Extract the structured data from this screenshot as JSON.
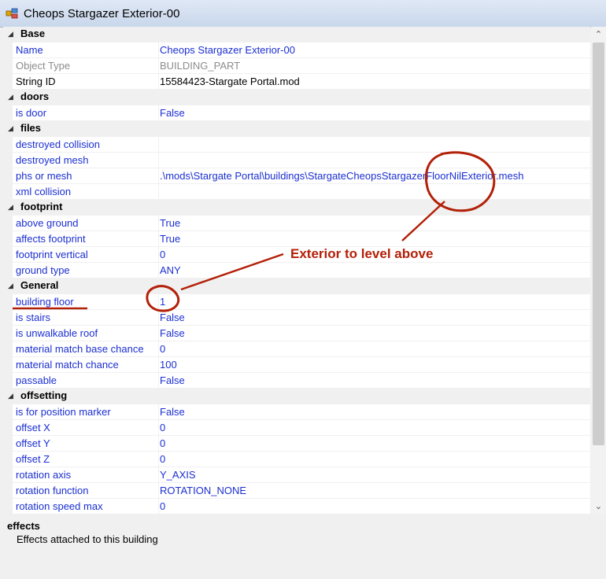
{
  "window": {
    "title": "Cheops Stargazer Exterior-00"
  },
  "grid": {
    "rows": [
      {
        "type": "category",
        "label": "Base"
      },
      {
        "type": "prop",
        "name": "Name",
        "value": "Cheops Stargazer Exterior-00",
        "state": "editable"
      },
      {
        "type": "prop",
        "name": "Object Type",
        "value": "BUILDING_PART",
        "state": "readonly"
      },
      {
        "type": "prop",
        "name": "String ID",
        "value": "15584423-Stargate Portal.mod",
        "state": "plain"
      },
      {
        "type": "category",
        "label": "doors"
      },
      {
        "type": "prop",
        "name": "is door",
        "value": "False",
        "state": "editable"
      },
      {
        "type": "category",
        "label": "files"
      },
      {
        "type": "prop",
        "name": "destroyed collision",
        "value": "",
        "state": "editable"
      },
      {
        "type": "prop",
        "name": "destroyed mesh",
        "value": "",
        "state": "editable"
      },
      {
        "type": "prop",
        "name": "phs or mesh",
        "value": ".\\mods\\Stargate Portal\\buildings\\StargateCheopsStargazerFloorNilExterior.mesh",
        "state": "editable"
      },
      {
        "type": "prop",
        "name": "xml collision",
        "value": "",
        "state": "editable"
      },
      {
        "type": "category",
        "label": "footprint"
      },
      {
        "type": "prop",
        "name": "above ground",
        "value": "True",
        "state": "editable"
      },
      {
        "type": "prop",
        "name": "affects footprint",
        "value": "True",
        "state": "editable"
      },
      {
        "type": "prop",
        "name": "footprint vertical",
        "value": "0",
        "state": "editable"
      },
      {
        "type": "prop",
        "name": "ground type",
        "value": "ANY",
        "state": "editable"
      },
      {
        "type": "category",
        "label": "General"
      },
      {
        "type": "prop",
        "name": "building floor",
        "value": "1",
        "state": "editable"
      },
      {
        "type": "prop",
        "name": "is stairs",
        "value": "False",
        "state": "editable"
      },
      {
        "type": "prop",
        "name": "is unwalkable roof",
        "value": "False",
        "state": "editable"
      },
      {
        "type": "prop",
        "name": "material match base chance",
        "value": "0",
        "state": "editable"
      },
      {
        "type": "prop",
        "name": "material match chance",
        "value": "100",
        "state": "editable"
      },
      {
        "type": "prop",
        "name": "passable",
        "value": "False",
        "state": "editable"
      },
      {
        "type": "category",
        "label": "offsetting"
      },
      {
        "type": "prop",
        "name": "is for position marker",
        "value": "False",
        "state": "editable"
      },
      {
        "type": "prop",
        "name": "offset X",
        "value": "0",
        "state": "editable"
      },
      {
        "type": "prop",
        "name": "offset Y",
        "value": "0",
        "state": "editable"
      },
      {
        "type": "prop",
        "name": "offset Z",
        "value": "0",
        "state": "editable"
      },
      {
        "type": "prop",
        "name": "rotation axis",
        "value": "Y_AXIS",
        "state": "editable"
      },
      {
        "type": "prop",
        "name": "rotation function",
        "value": "ROTATION_NONE",
        "state": "editable"
      },
      {
        "type": "prop",
        "name": "rotation speed max",
        "value": "0",
        "state": "editable"
      }
    ]
  },
  "help": {
    "title": "effects",
    "description": "Effects attached to this building"
  },
  "annotation": {
    "text": "Exterior to level above",
    "color": "#b32008"
  },
  "colors": {
    "value_text": "#1b2fd1",
    "readonly_text": "#8c8c8c",
    "annotation": "#b32008"
  }
}
